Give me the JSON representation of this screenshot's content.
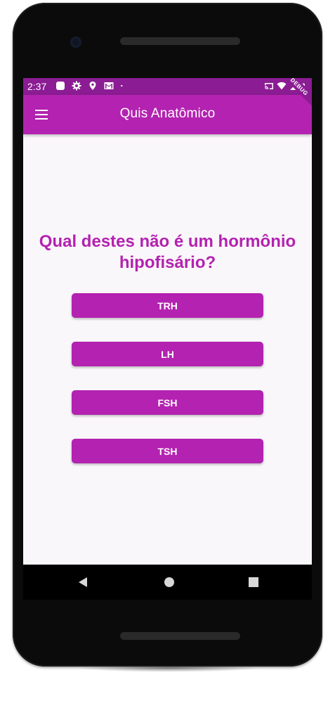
{
  "status_bar": {
    "time": "2:37",
    "left_icons": [
      "notification-square-icon",
      "settings-gear-icon",
      "location-pin-icon",
      "gmail-icon",
      "dot-icon"
    ],
    "right_icons": [
      "cast-icon",
      "wifi-icon",
      "signal-icon",
      "battery-icon"
    ]
  },
  "app_bar": {
    "title": "Quis Anatômico",
    "menu_icon": "hamburger-menu-icon",
    "debug_label": "DEBUG"
  },
  "quiz": {
    "question": "Qual destes não é um hormônio hipofisário?",
    "answers": [
      {
        "label": "TRH"
      },
      {
        "label": "LH"
      },
      {
        "label": "FSH"
      },
      {
        "label": "TSH"
      }
    ]
  },
  "nav_bar": {
    "icons": [
      "back-triangle-icon",
      "home-circle-icon",
      "recents-square-icon"
    ]
  },
  "colors": {
    "primary": "#b322b0",
    "status_bar": "#8b1c93",
    "background": "#faf7fa",
    "text_on_primary": "#ffffff"
  }
}
